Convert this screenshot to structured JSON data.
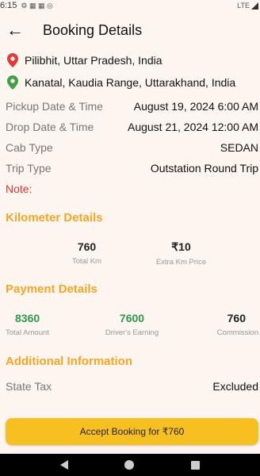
{
  "status": {
    "time": "6:15",
    "network": "LTE"
  },
  "header": {
    "title": "Booking Details"
  },
  "locations": {
    "pickup": "Pilibhit, Uttar Pradesh, India",
    "drop": "Kanatal, Kaudia Range, Uttarakhand, India"
  },
  "details": [
    {
      "label": "Pickup Date & Time",
      "value": "August 19, 2024 6:00 AM"
    },
    {
      "label": "Drop Date & Time",
      "value": "August 21, 2024 12:00 AM"
    },
    {
      "label": "Cab Type",
      "value": "SEDAN"
    },
    {
      "label": "Trip Type",
      "value": "Outstation Round Trip"
    }
  ],
  "note_label": "Note:",
  "km": {
    "title": "Kilometer Details",
    "total_km": "760",
    "total_km_label": "Total Km",
    "extra_price": "₹10",
    "extra_price_label": "Extra Km Price"
  },
  "payment": {
    "title": "Payment Details",
    "total_amount": "8360",
    "total_amount_label": "Total Amount",
    "driver_earning": "7600",
    "driver_earning_label": "Driver's Earning",
    "commission": "760",
    "commission_label": "Commission"
  },
  "additional": {
    "title": "Additional Information",
    "state_tax_label": "State Tax",
    "state_tax_value": "Excluded"
  },
  "action": {
    "accept_label": "Accept Booking for ₹760"
  },
  "colors": {
    "accent": "#f5a623",
    "button": "#f7c021",
    "green": "#2e9a4a",
    "note": "#dd3333",
    "background": "#fdf5ef"
  }
}
